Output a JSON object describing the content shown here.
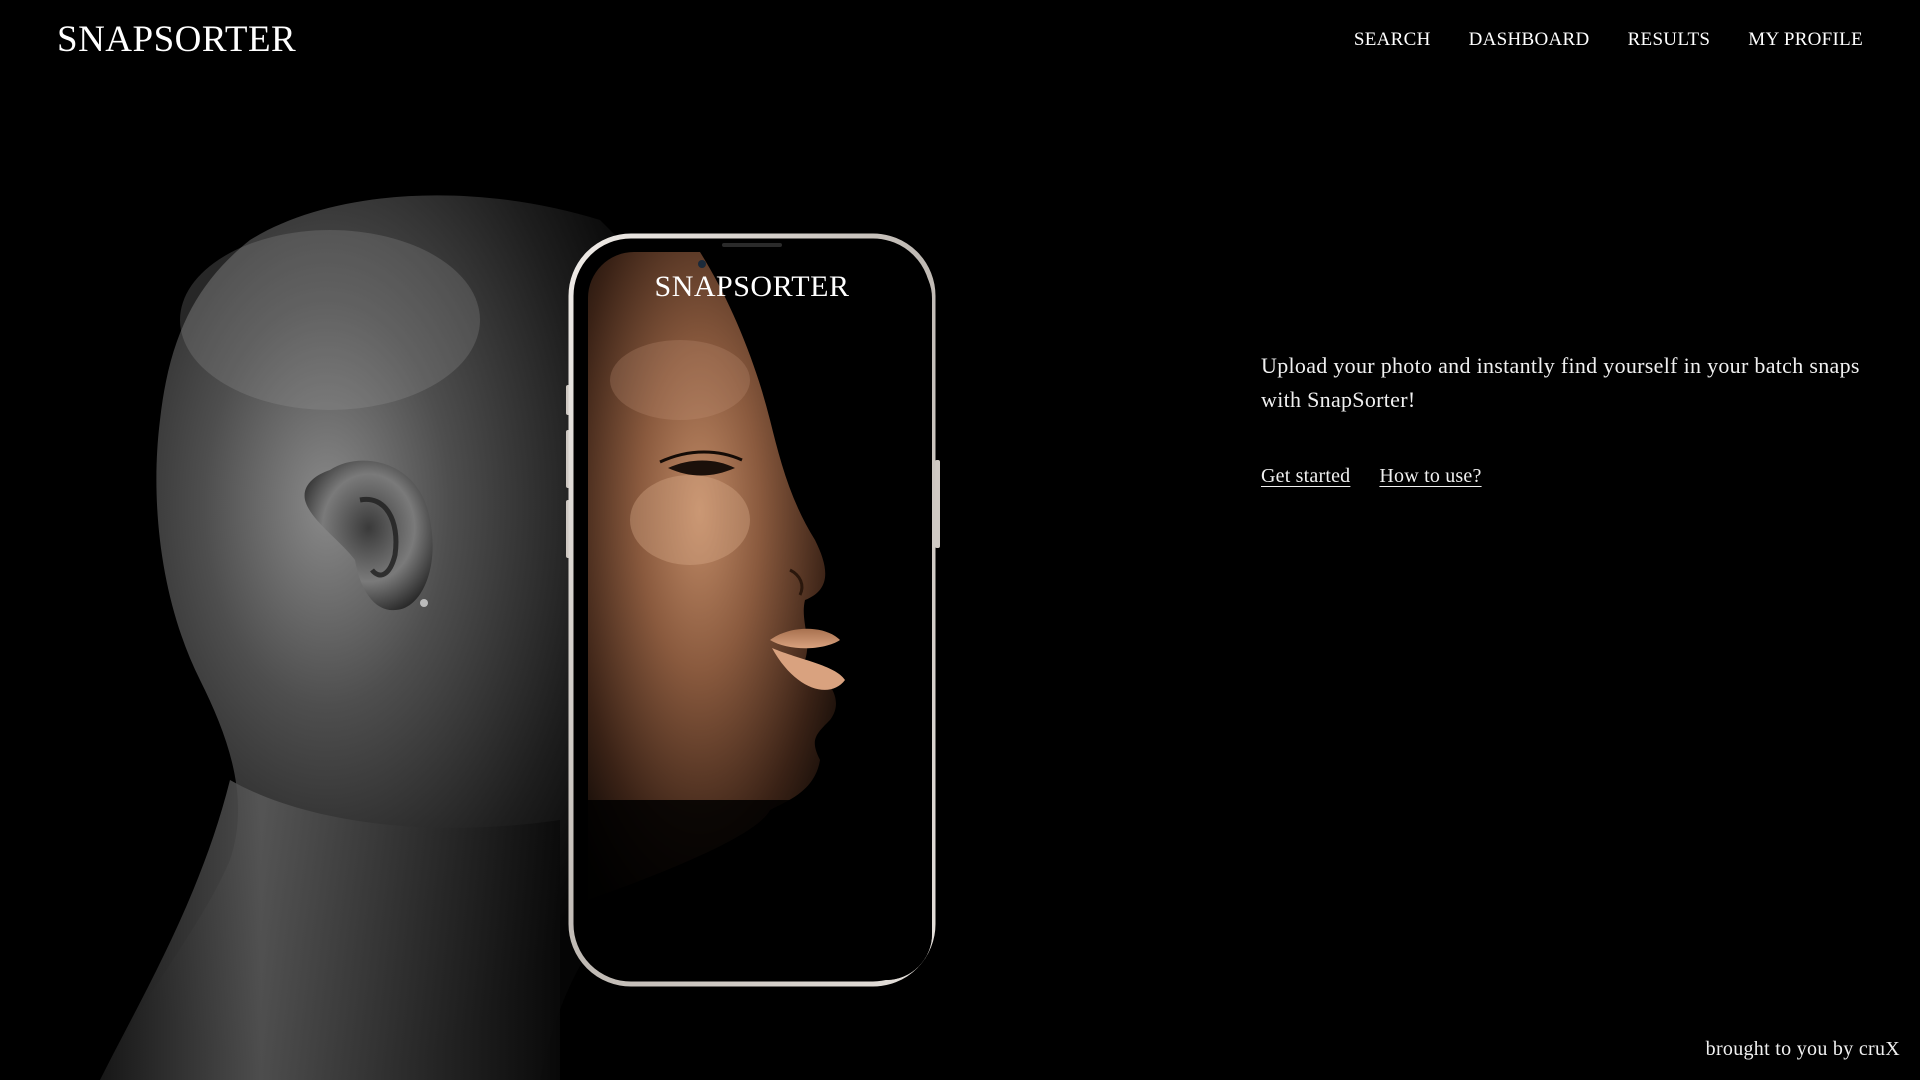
{
  "brand": {
    "name": "SNAPSORTER"
  },
  "nav": {
    "items": [
      {
        "label": "SEARCH"
      },
      {
        "label": "DASHBOARD"
      },
      {
        "label": "RESULTS"
      },
      {
        "label": "MY PROFILE"
      }
    ]
  },
  "phone": {
    "screen_title": "SNAPSORTER"
  },
  "hero": {
    "tagline": "Upload your photo and instantly find yourself in your batch snaps with SnapSorter!",
    "cta_primary": "Get started",
    "cta_secondary": "How to use?"
  },
  "footer": {
    "credit": "brought to you by cruX"
  },
  "colors": {
    "background": "#000000",
    "text": "#f2f2f2",
    "phone_frame": "#d9d4cf",
    "skin_gray": "#6a6a6a",
    "skin_warm": "#8a5a3e"
  }
}
